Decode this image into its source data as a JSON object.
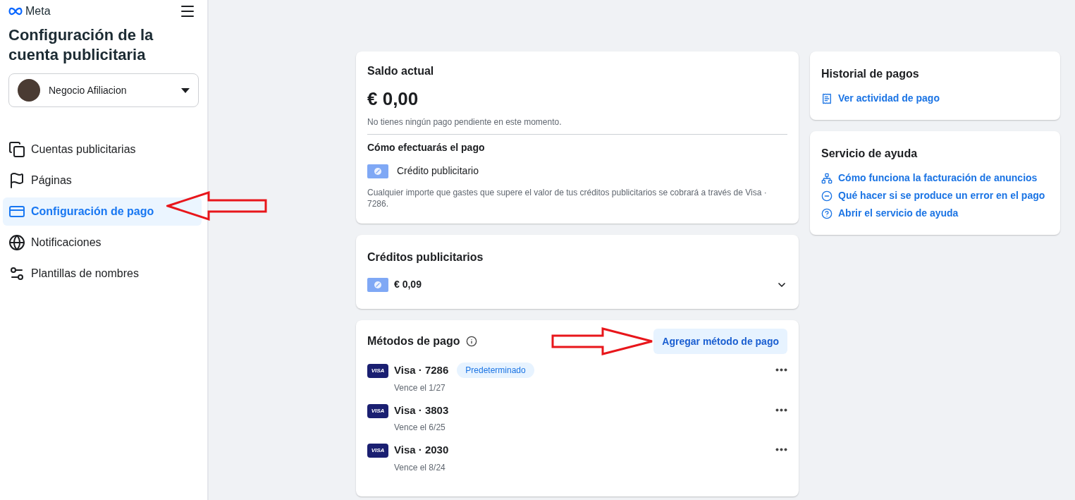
{
  "sidebar": {
    "logo": "Meta",
    "title": "Configuración de la cuenta publicitaria",
    "account": {
      "name": "Negocio Afiliacion"
    },
    "items": [
      {
        "label": "Cuentas publicitarias",
        "selected": false
      },
      {
        "label": "Páginas",
        "selected": false
      },
      {
        "label": "Configuración de pago",
        "selected": true
      },
      {
        "label": "Notificaciones",
        "selected": false
      },
      {
        "label": "Plantillas de nombres",
        "selected": false
      }
    ]
  },
  "balance": {
    "title": "Saldo actual",
    "amount": "€ 0,00",
    "note": "No tienes ningún pago pendiente en este momento.",
    "how_title": "Cómo efectuarás el pago",
    "method": "Crédito publicitario",
    "footnote": "Cualquier importe que gastes que supere el valor de tus créditos publicitarios se cobrará a través de Visa · 7286."
  },
  "credits": {
    "title": "Créditos publicitarios",
    "amount": "€ 0,09",
    "expanded": false
  },
  "payment_methods": {
    "title": "Métodos de pago",
    "add_button": "Agregar método de pago",
    "methods": [
      {
        "brand_mark": "VISA",
        "name": "Visa · 7286",
        "badge": "Predeterminado",
        "expiry": "Vence el 1/27"
      },
      {
        "brand_mark": "VISA",
        "name": "Visa · 3803",
        "expiry": "Vence el 6/25"
      },
      {
        "brand_mark": "VISA",
        "name": "Visa · 2030",
        "expiry": "Vence el 8/24"
      }
    ]
  },
  "history": {
    "title": "Historial de pagos",
    "link": "Ver actividad de pago"
  },
  "help": {
    "title": "Servicio de ayuda",
    "links": [
      "Cómo funciona la facturación de anuncios",
      "Qué hacer si se produce un error en el pago",
      "Abrir el servicio de ayuda"
    ]
  }
}
